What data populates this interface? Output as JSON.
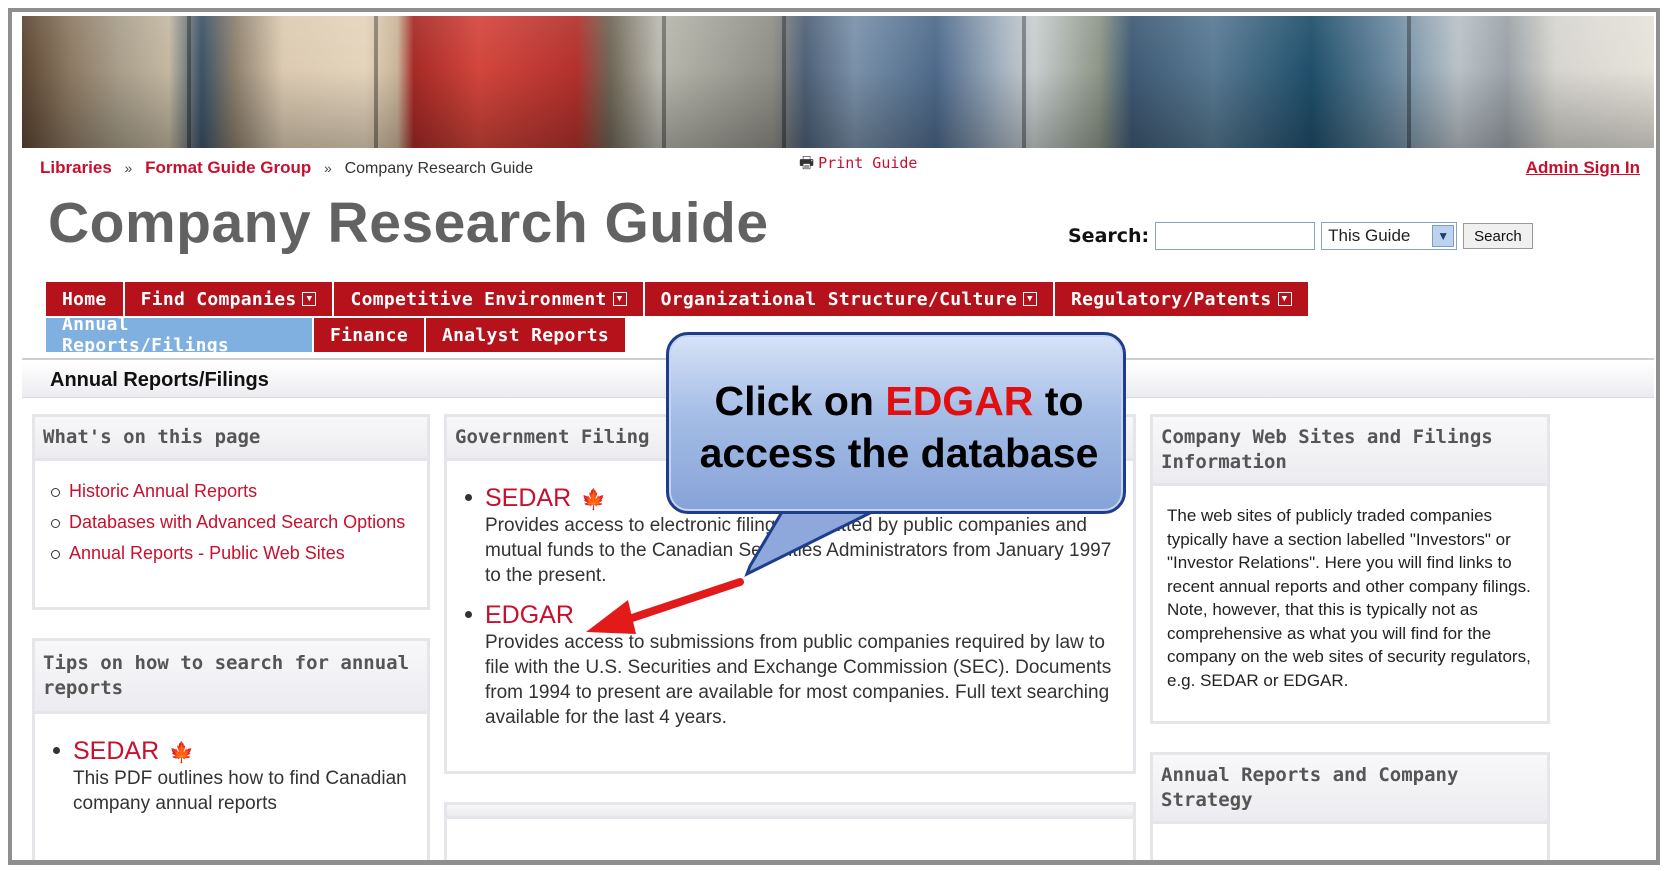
{
  "breadcrumb": {
    "items": [
      "Libraries",
      "Format Guide Group"
    ],
    "separator": "»",
    "current": "Company Research Guide"
  },
  "print_guide": "Print Guide",
  "admin_signin": "Admin Sign In",
  "guide_title": "Company Research Guide",
  "search": {
    "label": "Search:",
    "value": "",
    "scope": "This Guide",
    "button": "Search"
  },
  "tabs_row1": [
    {
      "label": "Home",
      "dropdown": false
    },
    {
      "label": "Find Companies",
      "dropdown": true
    },
    {
      "label": "Competitive Environment",
      "dropdown": true
    },
    {
      "label": "Organizational Structure/Culture",
      "dropdown": true
    },
    {
      "label": "Regulatory/Patents",
      "dropdown": true
    }
  ],
  "tabs_row2": [
    {
      "label": "Annual Reports/Filings",
      "active": true
    },
    {
      "label": "Finance",
      "active": false
    },
    {
      "label": "Analyst Reports",
      "active": false
    }
  ],
  "section_title": "Annual Reports/Filings",
  "whats_on_page": {
    "title": "What's on this page",
    "links": [
      "Historic Annual Reports",
      "Databases with Advanced Search Options",
      "Annual Reports - Public Web Sites"
    ]
  },
  "tips": {
    "title": "Tips on how to search for annual reports",
    "item_label": "SEDAR",
    "item_desc": "This PDF outlines how to find Canadian company annual reports"
  },
  "government_filings": {
    "title": "Government Filing",
    "items": [
      {
        "label": "SEDAR",
        "desc": "Provides access to electronic filings submitted by public companies and mutual funds to the Canadian Securities Administrators from January 1997 to the present."
      },
      {
        "label": "EDGAR",
        "desc": "Provides access to submissions from public companies required by law to file with the U.S. Securities and Exchange Commission (SEC). Documents from 1994 to present are available for most companies. Full text searching available for the last 4 years."
      }
    ]
  },
  "company_web_sites": {
    "title": "Company Web Sites and Filings Information",
    "text": "The web sites of publicly traded companies typically have a section labelled \"Investors\" or \"Investor Relations\". Here you will find links to recent annual reports and other company filings. Note, however, that this is typically not as comprehensive as what you will find for the company on the web sites of security regulators, e.g. SEDAR or EDGAR."
  },
  "annual_strategy": {
    "title": "Annual Reports and Company Strategy"
  },
  "callout": {
    "line1_pre": "Click on ",
    "line1_highlight": "EDGAR",
    "line1_post": " to",
    "line2": "access the database"
  },
  "colors": {
    "brand_red": "#b5121b",
    "link_red": "#c8102e",
    "active_tab": "#7fb0e0",
    "callout_border": "#1e3d8c",
    "arrow": "#e21a1a"
  },
  "icons": {
    "print": "printer-icon",
    "leaf": "maple-leaf-icon",
    "dropdown": "dropdown-arrow-icon"
  }
}
